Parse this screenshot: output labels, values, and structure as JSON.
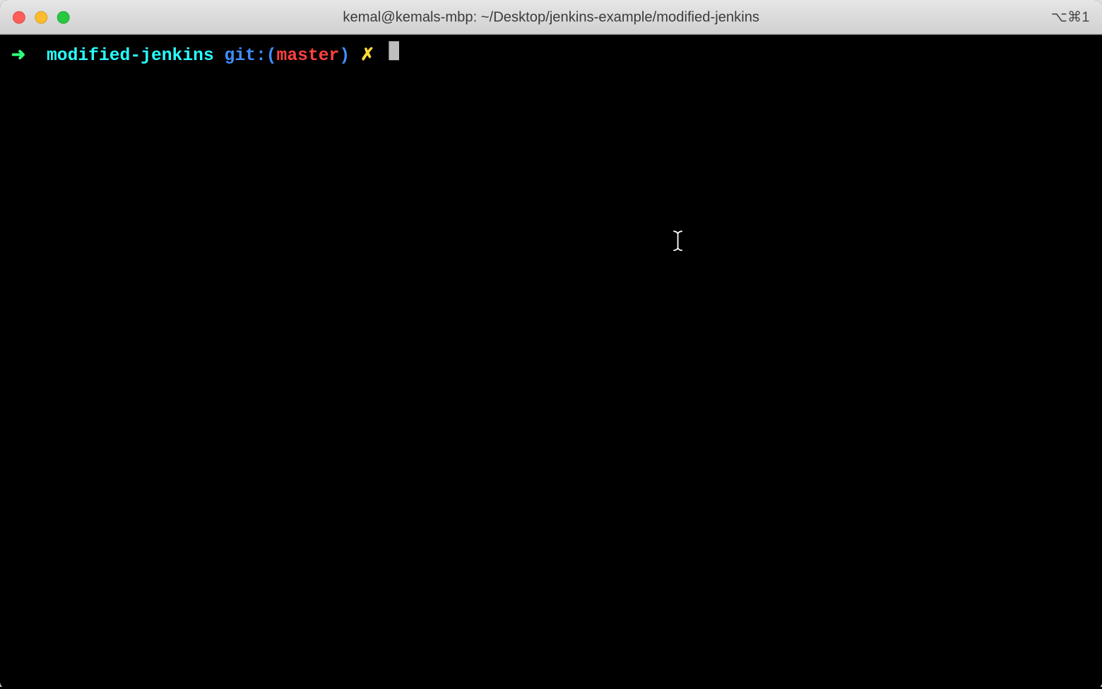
{
  "window": {
    "title": "kemal@kemals-mbp: ~/Desktop/jenkins-example/modified-jenkins",
    "shortcut_hint": "⌥⌘1"
  },
  "prompt": {
    "arrow": "➜",
    "cwd": "modified-jenkins",
    "git_label": "git:",
    "paren_open": "(",
    "branch": "master",
    "paren_close": ")",
    "dirty_marker": "✗"
  }
}
